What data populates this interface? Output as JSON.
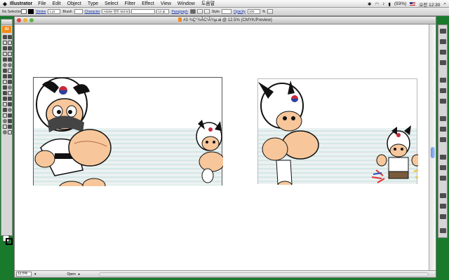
{
  "menubar": {
    "apple": "",
    "app": "Illustrator",
    "items": [
      "File",
      "Edit",
      "Object",
      "Type",
      "Select",
      "Filter",
      "Effect",
      "View",
      "Window",
      "도움말"
    ],
    "status": {
      "battery": "(93%)",
      "clock": "오전 12:30"
    }
  },
  "controlbar": {
    "selection": "No Selection",
    "stroke_label": "Stroke",
    "stroke_weight": "1 pt",
    "brush_label": "Brush",
    "character_label": "Character",
    "font": "Adobe 명조 Std M",
    "font_size": "12 pt",
    "paragraph_label": "Paragraph",
    "style_label": "Style",
    "opacity_label": "Opacity",
    "opacity_value": "100",
    "opacity_unit": "%"
  },
  "document": {
    "title": "#3 ¾Ç°½ÃC¹Ã¾µ.ai @ 12.5% (CMYK/Preview)",
    "zoom": "12.5%",
    "status": "Open"
  },
  "tools": {
    "badge": "Ai"
  },
  "colors": {
    "desktop": "#1a7a2c",
    "ai_orange": "#f48a1a",
    "close": "#e2463c",
    "minimize": "#e8b43a",
    "zoom": "#5fb54a"
  }
}
